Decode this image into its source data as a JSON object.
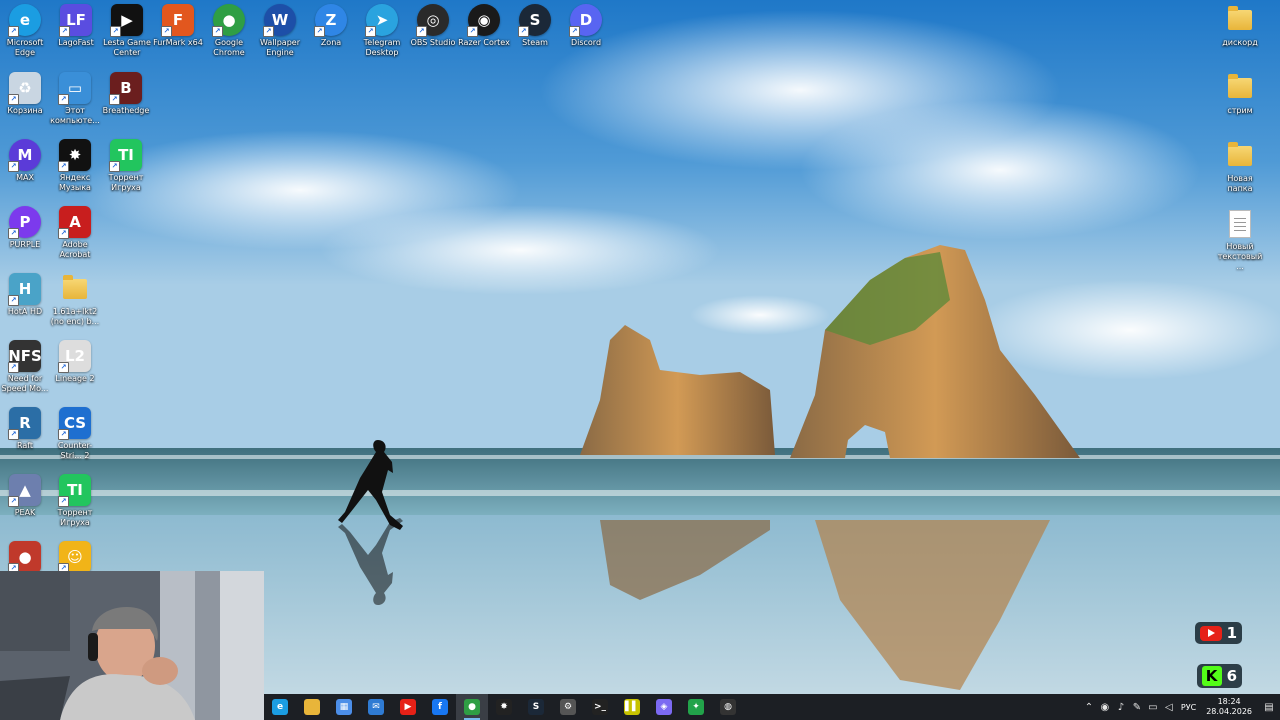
{
  "desktop": {
    "icons_row1": [
      {
        "label": "Microsoft Edge",
        "icon": "edge-icon",
        "color": "#1b9de2"
      },
      {
        "label": "LagoFast",
        "icon": "lagofast-icon",
        "color": "#5a4de0"
      },
      {
        "label": "Lesta Game Center",
        "icon": "lesta-icon",
        "color": "#111111"
      },
      {
        "label": "FurMark x64",
        "icon": "furmark-icon",
        "color": "#e2571e"
      },
      {
        "label": "Google Chrome",
        "icon": "chrome-icon",
        "color": "#2f9e44"
      },
      {
        "label": "Wallpaper Engine",
        "icon": "wallpaper-engine-icon",
        "color": "#1d4fa8"
      },
      {
        "label": "Zona",
        "icon": "zona-icon",
        "color": "#2f86e6"
      },
      {
        "label": "Telegram Desktop",
        "icon": "telegram-icon",
        "color": "#2aa3df"
      },
      {
        "label": "OBS Studio",
        "icon": "obs-icon",
        "color": "#2a2a2a"
      },
      {
        "label": "Razer Cortex",
        "icon": "razer-cortex-icon",
        "color": "#1a1a1a"
      },
      {
        "label": "Steam",
        "icon": "steam-icon",
        "color": "#1b2838"
      },
      {
        "label": "Discord",
        "icon": "discord-icon",
        "color": "#5865f2"
      }
    ],
    "icons_col": [
      {
        "label": "Корзина",
        "icon": "recycle-bin-icon",
        "color": "#c9d6e2"
      },
      {
        "label": "Этот компьюте...",
        "icon": "this-pc-icon",
        "color": "#3a8fd8"
      },
      {
        "label": "Breathedge",
        "icon": "breathedge-icon",
        "color": "#6b1e1e"
      },
      {
        "label": "MAX",
        "icon": "max-icon",
        "color": "#5b3bd8"
      },
      {
        "label": "Яндекс Музыка",
        "icon": "yandex-music-icon",
        "color": "#111111"
      },
      {
        "label": "Торрент Игруха",
        "icon": "torrent-igruha-icon",
        "color": "#22c55e"
      },
      {
        "label": "PURPLE",
        "icon": "purple-icon",
        "color": "#7c3aed"
      },
      {
        "label": "Adobe Acrobat",
        "icon": "acrobat-icon",
        "color": "#c81e1e"
      },
      {
        "label": "HotA HD",
        "icon": "hota-icon",
        "color": "#4aa3c8"
      },
      {
        "label": "1.61a+lkt2 (no enc) b...",
        "icon": "folder-icon",
        "color": "#e8b53a"
      },
      {
        "label": "Need for Speed Mo...",
        "icon": "nfs-icon",
        "color": "#333333"
      },
      {
        "label": "Lineage 2",
        "icon": "lineage2-icon",
        "color": "#dddddd"
      },
      {
        "label": "Raft",
        "icon": "raft-icon",
        "color": "#2b6ea6"
      },
      {
        "label": "Counter-Stri... 2",
        "icon": "cs2-icon",
        "color": "#1e6fd0"
      },
      {
        "label": "PEAK",
        "icon": "peak-icon",
        "color": "#6d7fae"
      },
      {
        "label": "Торрент Игруха",
        "icon": "torrent-igruha-icon",
        "color": "#22c55e"
      },
      {
        "label": "",
        "icon": "app-red-icon",
        "color": "#c0392b"
      },
      {
        "label": "",
        "icon": "smiley-icon",
        "color": "#f1b418"
      }
    ],
    "icons_right": [
      {
        "label": "дискорд",
        "icon": "folder-icon"
      },
      {
        "label": "стрим",
        "icon": "folder-icon"
      },
      {
        "label": "Новая папка",
        "icon": "folder-icon"
      },
      {
        "label": "Новый текстовый ...",
        "icon": "text-file-icon"
      }
    ]
  },
  "badges": {
    "youtube_count": "1",
    "kick_count": "6",
    "youtube_color": "#e62117",
    "kick_color": "#53fc18"
  },
  "taskbar": {
    "apps": [
      {
        "name": "edge",
        "icon": "edge-icon",
        "color": "#1b9de2"
      },
      {
        "name": "file-explorer",
        "icon": "folder-icon",
        "color": "#e8b53a"
      },
      {
        "name": "store",
        "icon": "store-icon",
        "color": "#4c8ee8"
      },
      {
        "name": "mail",
        "icon": "mail-icon",
        "color": "#2f7bd3"
      },
      {
        "name": "youtube",
        "icon": "youtube-icon",
        "color": "#e62117"
      },
      {
        "name": "facebook",
        "icon": "facebook-icon",
        "color": "#1877f2"
      },
      {
        "name": "chrome",
        "icon": "chrome-icon",
        "color": "#2f9e44",
        "active": true
      },
      {
        "name": "yandex-music",
        "icon": "yandex-music-icon",
        "color": "#222222"
      },
      {
        "name": "steam",
        "icon": "steam-icon",
        "color": "#1b2838"
      },
      {
        "name": "settings",
        "icon": "gear-icon",
        "color": "#555555"
      },
      {
        "name": "terminal",
        "icon": "terminal-icon",
        "color": "#222222"
      },
      {
        "name": "app-yellow",
        "icon": "pause-icon",
        "color": "#c7c200"
      },
      {
        "name": "app-purple",
        "icon": "purple-app-icon",
        "color": "#7c6af2"
      },
      {
        "name": "app-green",
        "icon": "green-app-icon",
        "color": "#22a34a"
      },
      {
        "name": "app-dark",
        "icon": "dark-app-icon",
        "color": "#333333"
      }
    ],
    "language": "РУС",
    "time": "18:24",
    "date": "28.04.2026"
  }
}
